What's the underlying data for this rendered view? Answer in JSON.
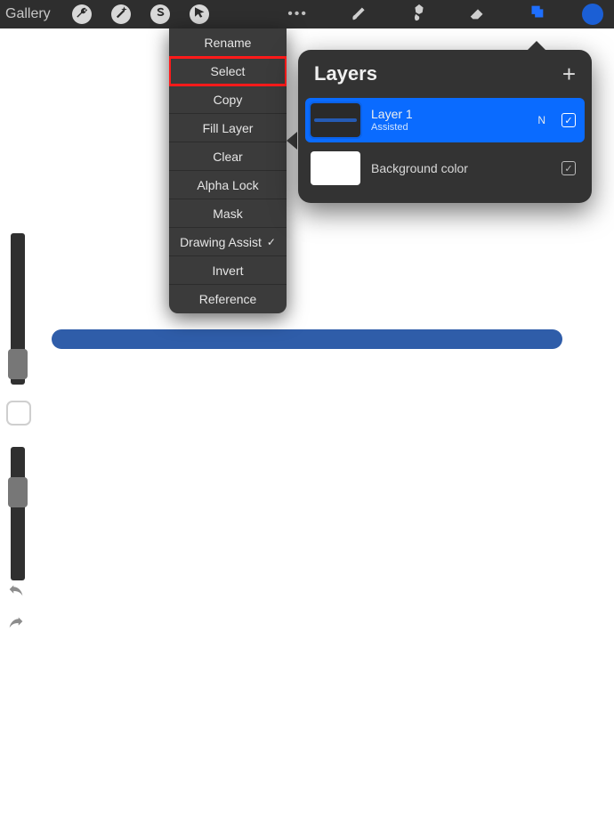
{
  "topbar": {
    "gallery_label": "Gallery",
    "more_label": "•••"
  },
  "context_menu": {
    "items": [
      {
        "label": "Rename",
        "checked": false,
        "highlight": false
      },
      {
        "label": "Select",
        "checked": false,
        "highlight": true
      },
      {
        "label": "Copy",
        "checked": false,
        "highlight": false
      },
      {
        "label": "Fill Layer",
        "checked": false,
        "highlight": false
      },
      {
        "label": "Clear",
        "checked": false,
        "highlight": false
      },
      {
        "label": "Alpha Lock",
        "checked": false,
        "highlight": false
      },
      {
        "label": "Mask",
        "checked": false,
        "highlight": false
      },
      {
        "label": "Drawing Assist",
        "checked": true,
        "highlight": false
      },
      {
        "label": "Invert",
        "checked": false,
        "highlight": false
      },
      {
        "label": "Reference",
        "checked": false,
        "highlight": false
      }
    ]
  },
  "layers_panel": {
    "title": "Layers",
    "add_label": "+",
    "layers": [
      {
        "name": "Layer 1",
        "subtitle": "Assisted",
        "blend": "N",
        "visible": true,
        "selected": true,
        "type": "artwork"
      },
      {
        "name": "Background color",
        "subtitle": "",
        "blend": "",
        "visible": true,
        "selected": false,
        "type": "background"
      }
    ]
  },
  "colors": {
    "accent": "#1e6fff",
    "stroke": "#2f5da9",
    "current_color": "#1b5fd5"
  },
  "checkmark": "✓"
}
